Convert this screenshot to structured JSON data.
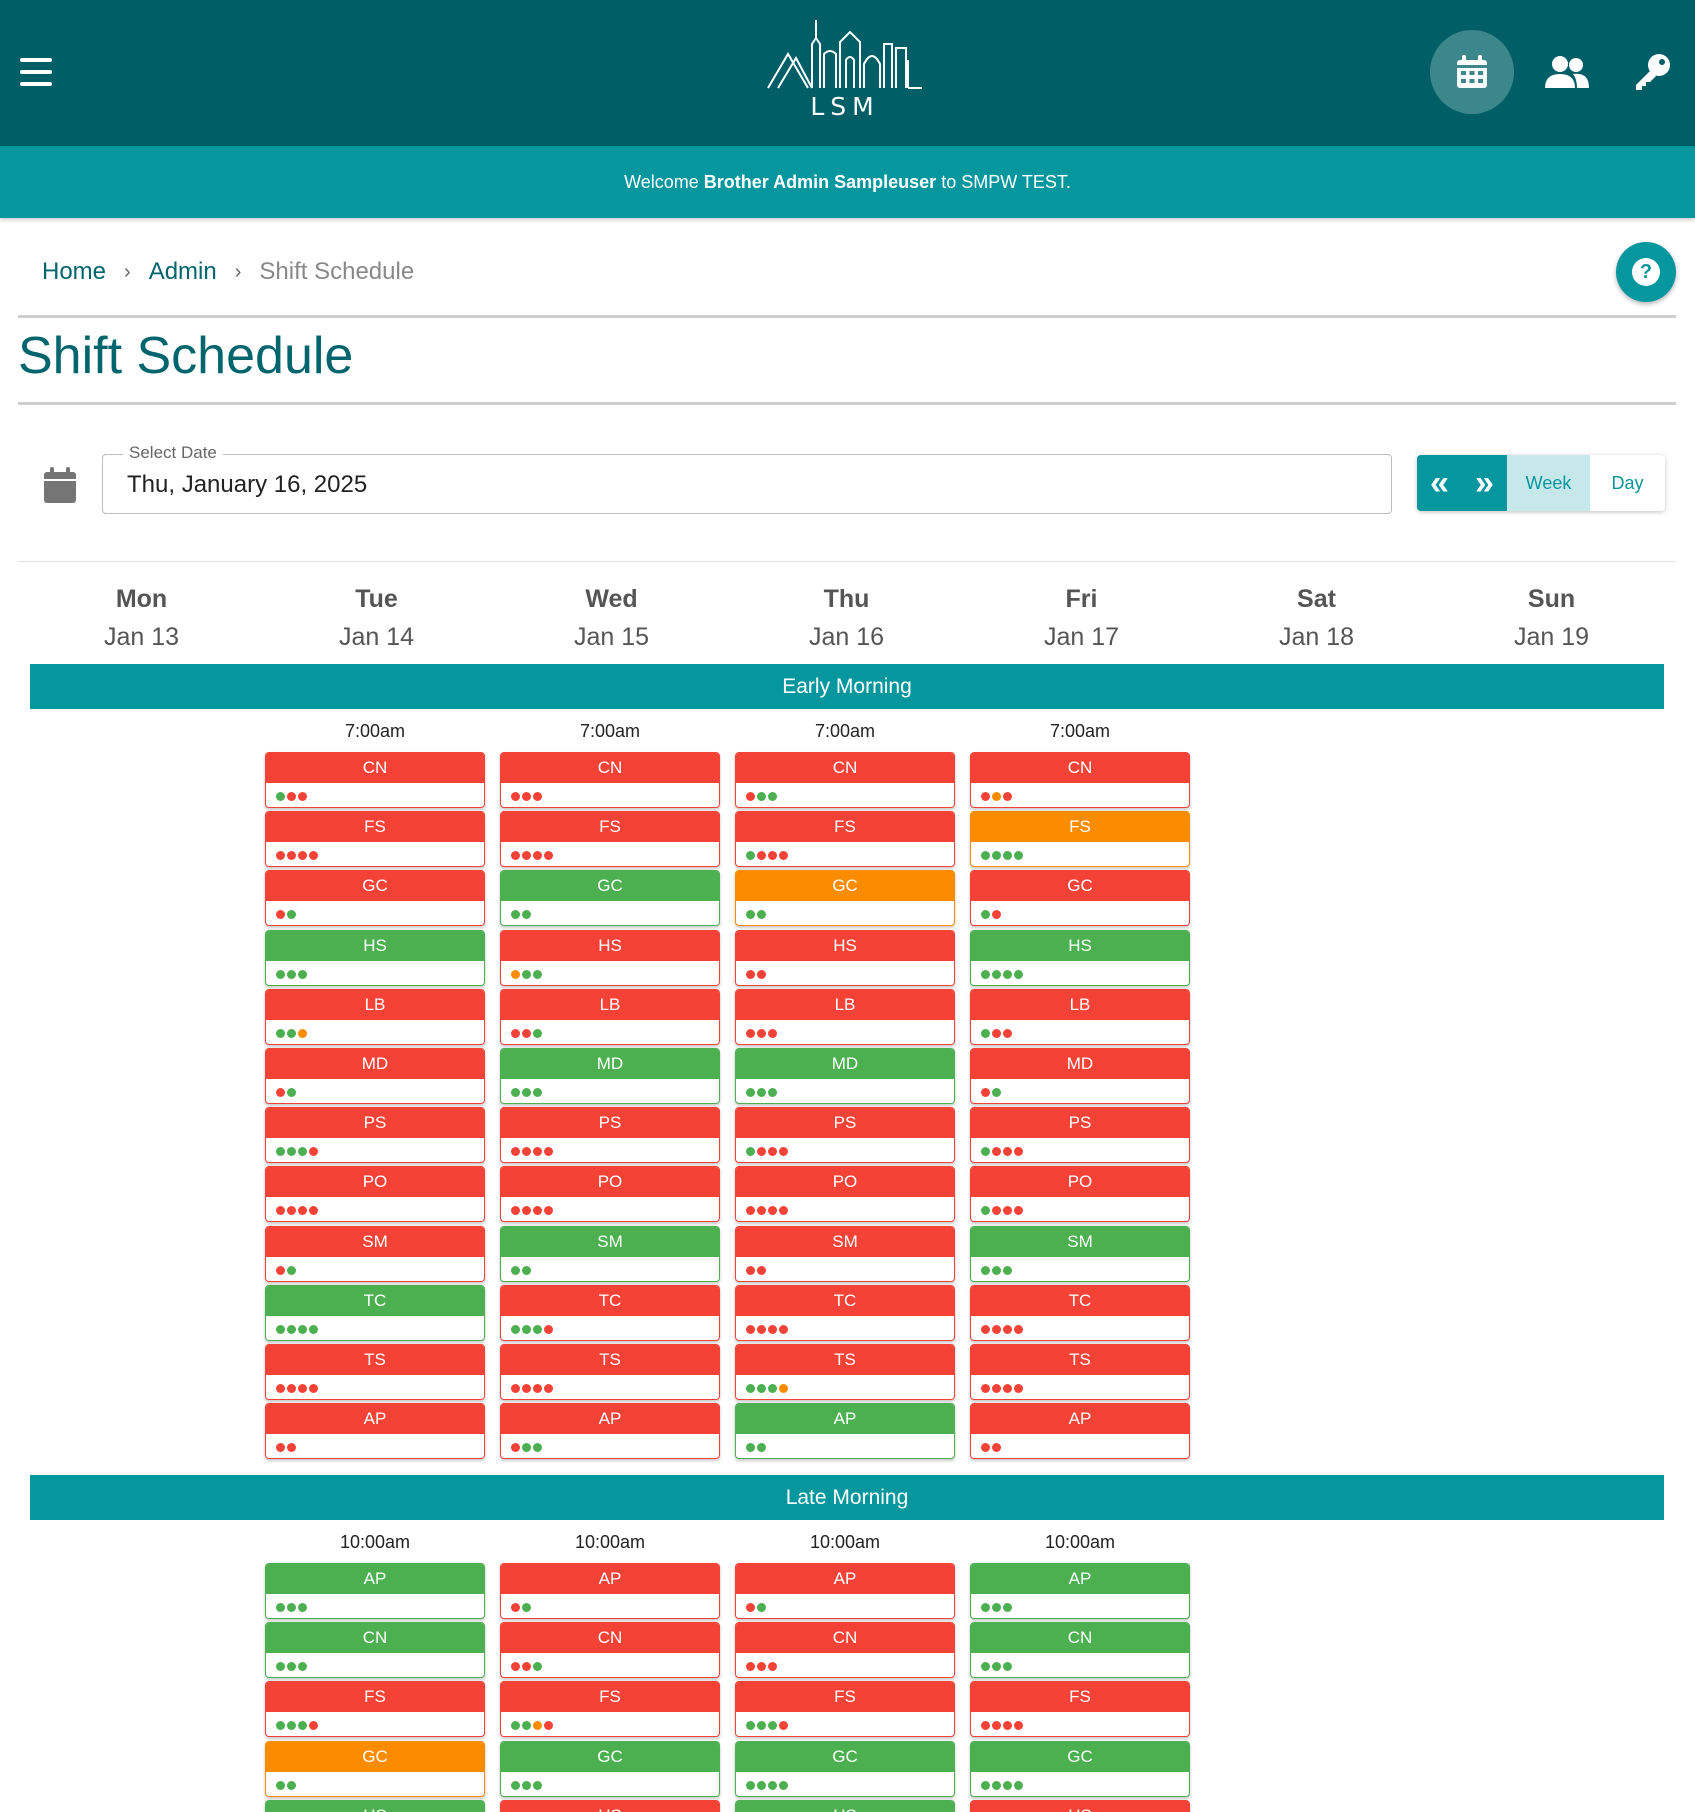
{
  "app": {
    "logo_text": "LSM",
    "colors": {
      "red": "#f44336",
      "green": "#4caf50",
      "orange": "#fb8c00",
      "teal_dark": "#005f66",
      "teal": "#06969e"
    }
  },
  "nav": {
    "icons": [
      "menu-icon",
      "calendar-icon",
      "users-icon",
      "key-icon"
    ],
    "active": "calendar-icon"
  },
  "welcome": {
    "prefix": "Welcome ",
    "name": "Brother Admin Sampleuser",
    "suffix": " to SMPW TEST."
  },
  "breadcrumb": {
    "home": "Home",
    "admin": "Admin",
    "current": "Shift Schedule",
    "separator": "›"
  },
  "help": {
    "icon": "?"
  },
  "page": {
    "title": "Shift Schedule"
  },
  "date_picker": {
    "label": "Select Date",
    "value": "Thu, January 16, 2025"
  },
  "view_toggle": {
    "prev": "«",
    "next": "»",
    "week": "Week",
    "day": "Day",
    "selected": "Week"
  },
  "days": [
    {
      "name": "Mon",
      "date": "Jan 13"
    },
    {
      "name": "Tue",
      "date": "Jan 14"
    },
    {
      "name": "Wed",
      "date": "Jan 15"
    },
    {
      "name": "Thu",
      "date": "Jan 16"
    },
    {
      "name": "Fri",
      "date": "Jan 17"
    },
    {
      "name": "Sat",
      "date": "Jan 18"
    },
    {
      "name": "Sun",
      "date": "Jan 19"
    }
  ],
  "sections": [
    {
      "title": "Early Morning",
      "columns": [
        {
          "day": "Tue",
          "time": "7:00am",
          "shifts": [
            {
              "label": "CN",
              "status": "red",
              "dots": [
                "green",
                "red",
                "red"
              ]
            },
            {
              "label": "FS",
              "status": "red",
              "dots": [
                "red",
                "red",
                "red",
                "red"
              ]
            },
            {
              "label": "GC",
              "status": "red",
              "dots": [
                "red",
                "green"
              ]
            },
            {
              "label": "HS",
              "status": "green",
              "dots": [
                "green",
                "green",
                "green"
              ]
            },
            {
              "label": "LB",
              "status": "red",
              "dots": [
                "green",
                "green",
                "orange"
              ]
            },
            {
              "label": "MD",
              "status": "red",
              "dots": [
                "red",
                "green"
              ]
            },
            {
              "label": "PS",
              "status": "red",
              "dots": [
                "green",
                "green",
                "green",
                "red"
              ]
            },
            {
              "label": "PO",
              "status": "red",
              "dots": [
                "red",
                "red",
                "red",
                "red"
              ]
            },
            {
              "label": "SM",
              "status": "red",
              "dots": [
                "red",
                "green"
              ]
            },
            {
              "label": "TC",
              "status": "green",
              "dots": [
                "green",
                "green",
                "green",
                "green"
              ]
            },
            {
              "label": "TS",
              "status": "red",
              "dots": [
                "red",
                "red",
                "red",
                "red"
              ]
            },
            {
              "label": "AP",
              "status": "red",
              "dots": [
                "red",
                "red"
              ]
            }
          ]
        },
        {
          "day": "Wed",
          "time": "7:00am",
          "shifts": [
            {
              "label": "CN",
              "status": "red",
              "dots": [
                "red",
                "red",
                "red"
              ]
            },
            {
              "label": "FS",
              "status": "red",
              "dots": [
                "red",
                "red",
                "red",
                "red"
              ]
            },
            {
              "label": "GC",
              "status": "green",
              "dots": [
                "green",
                "green"
              ]
            },
            {
              "label": "HS",
              "status": "red",
              "dots": [
                "orange",
                "green",
                "green"
              ]
            },
            {
              "label": "LB",
              "status": "red",
              "dots": [
                "red",
                "red",
                "green"
              ]
            },
            {
              "label": "MD",
              "status": "green",
              "dots": [
                "green",
                "green",
                "green"
              ]
            },
            {
              "label": "PS",
              "status": "red",
              "dots": [
                "red",
                "red",
                "red",
                "red"
              ]
            },
            {
              "label": "PO",
              "status": "red",
              "dots": [
                "red",
                "red",
                "red",
                "red"
              ]
            },
            {
              "label": "SM",
              "status": "green",
              "dots": [
                "green",
                "green"
              ]
            },
            {
              "label": "TC",
              "status": "red",
              "dots": [
                "green",
                "green",
                "green",
                "red"
              ]
            },
            {
              "label": "TS",
              "status": "red",
              "dots": [
                "red",
                "red",
                "red",
                "red"
              ]
            },
            {
              "label": "AP",
              "status": "red",
              "dots": [
                "red",
                "green",
                "green"
              ]
            }
          ]
        },
        {
          "day": "Thu",
          "time": "7:00am",
          "shifts": [
            {
              "label": "CN",
              "status": "red",
              "dots": [
                "red",
                "green",
                "green"
              ]
            },
            {
              "label": "FS",
              "status": "red",
              "dots": [
                "green",
                "red",
                "red",
                "red"
              ]
            },
            {
              "label": "GC",
              "status": "orange",
              "dots": [
                "green",
                "green"
              ]
            },
            {
              "label": "HS",
              "status": "red",
              "dots": [
                "red",
                "red"
              ]
            },
            {
              "label": "LB",
              "status": "red",
              "dots": [
                "red",
                "red",
                "red"
              ]
            },
            {
              "label": "MD",
              "status": "green",
              "dots": [
                "green",
                "green",
                "green"
              ]
            },
            {
              "label": "PS",
              "status": "red",
              "dots": [
                "green",
                "red",
                "red",
                "red"
              ]
            },
            {
              "label": "PO",
              "status": "red",
              "dots": [
                "red",
                "red",
                "red",
                "red"
              ]
            },
            {
              "label": "SM",
              "status": "red",
              "dots": [
                "red",
                "red"
              ]
            },
            {
              "label": "TC",
              "status": "red",
              "dots": [
                "red",
                "red",
                "red",
                "red"
              ]
            },
            {
              "label": "TS",
              "status": "red",
              "dots": [
                "green",
                "green",
                "green",
                "orange"
              ]
            },
            {
              "label": "AP",
              "status": "green",
              "dots": [
                "green",
                "green"
              ]
            }
          ]
        },
        {
          "day": "Fri",
          "time": "7:00am",
          "shifts": [
            {
              "label": "CN",
              "status": "red",
              "dots": [
                "red",
                "orange",
                "red"
              ]
            },
            {
              "label": "FS",
              "status": "orange",
              "dots": [
                "green",
                "green",
                "green",
                "green"
              ]
            },
            {
              "label": "GC",
              "status": "red",
              "dots": [
                "green",
                "red"
              ]
            },
            {
              "label": "HS",
              "status": "green",
              "dots": [
                "green",
                "green",
                "green",
                "green"
              ]
            },
            {
              "label": "LB",
              "status": "red",
              "dots": [
                "green",
                "red",
                "red"
              ]
            },
            {
              "label": "MD",
              "status": "red",
              "dots": [
                "red",
                "green"
              ]
            },
            {
              "label": "PS",
              "status": "red",
              "dots": [
                "green",
                "red",
                "red",
                "red"
              ]
            },
            {
              "label": "PO",
              "status": "red",
              "dots": [
                "green",
                "red",
                "red",
                "red"
              ]
            },
            {
              "label": "SM",
              "status": "green",
              "dots": [
                "green",
                "green",
                "green"
              ]
            },
            {
              "label": "TC",
              "status": "red",
              "dots": [
                "red",
                "red",
                "red",
                "red"
              ]
            },
            {
              "label": "TS",
              "status": "red",
              "dots": [
                "red",
                "red",
                "red",
                "red"
              ]
            },
            {
              "label": "AP",
              "status": "red",
              "dots": [
                "red",
                "red"
              ]
            }
          ]
        }
      ]
    },
    {
      "title": "Late Morning",
      "columns": [
        {
          "day": "Tue",
          "time": "10:00am",
          "shifts": [
            {
              "label": "AP",
              "status": "green",
              "dots": [
                "green",
                "green",
                "green"
              ]
            },
            {
              "label": "CN",
              "status": "green",
              "dots": [
                "green",
                "green",
                "green"
              ]
            },
            {
              "label": "FS",
              "status": "red",
              "dots": [
                "green",
                "green",
                "green",
                "red"
              ]
            },
            {
              "label": "GC",
              "status": "orange",
              "dots": [
                "green",
                "green"
              ]
            },
            {
              "label": "HS",
              "status": "green",
              "dots": []
            }
          ]
        },
        {
          "day": "Wed",
          "time": "10:00am",
          "shifts": [
            {
              "label": "AP",
              "status": "red",
              "dots": [
                "red",
                "green"
              ]
            },
            {
              "label": "CN",
              "status": "red",
              "dots": [
                "red",
                "red",
                "green"
              ]
            },
            {
              "label": "FS",
              "status": "red",
              "dots": [
                "green",
                "green",
                "orange",
                "red"
              ]
            },
            {
              "label": "GC",
              "status": "green",
              "dots": [
                "green",
                "green",
                "green"
              ]
            },
            {
              "label": "HS",
              "status": "red",
              "dots": []
            }
          ]
        },
        {
          "day": "Thu",
          "time": "10:00am",
          "shifts": [
            {
              "label": "AP",
              "status": "red",
              "dots": [
                "red",
                "green"
              ]
            },
            {
              "label": "CN",
              "status": "red",
              "dots": [
                "red",
                "red",
                "red"
              ]
            },
            {
              "label": "FS",
              "status": "red",
              "dots": [
                "green",
                "green",
                "green",
                "red"
              ]
            },
            {
              "label": "GC",
              "status": "green",
              "dots": [
                "green",
                "green",
                "green",
                "green"
              ]
            },
            {
              "label": "HS",
              "status": "green",
              "dots": []
            }
          ]
        },
        {
          "day": "Fri",
          "time": "10:00am",
          "shifts": [
            {
              "label": "AP",
              "status": "green",
              "dots": [
                "green",
                "green",
                "green"
              ]
            },
            {
              "label": "CN",
              "status": "green",
              "dots": [
                "green",
                "green",
                "green"
              ]
            },
            {
              "label": "FS",
              "status": "red",
              "dots": [
                "red",
                "red",
                "red",
                "red"
              ]
            },
            {
              "label": "GC",
              "status": "green",
              "dots": [
                "green",
                "green",
                "green",
                "green"
              ]
            },
            {
              "label": "HS",
              "status": "red",
              "dots": []
            }
          ]
        }
      ]
    }
  ]
}
